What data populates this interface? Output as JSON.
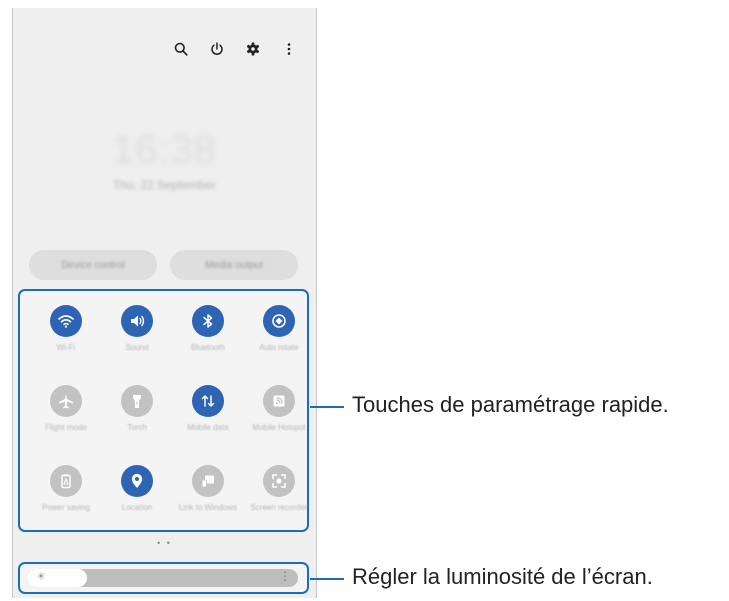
{
  "colors": {
    "accent": "#2e64b4",
    "callout": "#1a6cc0",
    "tile_off": "#c2c2c2"
  },
  "top_icons": [
    "search-icon",
    "power-icon",
    "gear-icon",
    "more-vert-icon"
  ],
  "lock_time": "16:38",
  "lock_date": "Thu, 22 September",
  "device_control_label": "Device control",
  "media_output_label": "Media output",
  "tiles": [
    {
      "label": "Wi-Fi",
      "icon": "wifi-icon",
      "active": true
    },
    {
      "label": "Sound",
      "icon": "sound-icon",
      "active": true
    },
    {
      "label": "Bluetooth",
      "icon": "bluetooth-icon",
      "active": true
    },
    {
      "label": "Auto rotate",
      "icon": "auto-rotate-icon",
      "active": true
    },
    {
      "label": "Flight mode",
      "icon": "airplane-icon",
      "active": false
    },
    {
      "label": "Torch",
      "icon": "torch-icon",
      "active": false
    },
    {
      "label": "Mobile data",
      "icon": "mobile-data-icon",
      "active": true
    },
    {
      "label": "Mobile Hotspot",
      "icon": "hotspot-icon",
      "active": false
    },
    {
      "label": "Power saving",
      "icon": "power-saving-icon",
      "active": false
    },
    {
      "label": "Location",
      "icon": "location-icon",
      "active": true
    },
    {
      "label": "Link to Windows",
      "icon": "link-windows-icon",
      "active": false
    },
    {
      "label": "Screen recorder",
      "icon": "screen-recorder-icon",
      "active": false
    }
  ],
  "page_indicator": "• •",
  "brightness": {
    "level": 0.22,
    "icon": "sun-icon"
  },
  "callouts": {
    "quick_settings": "Touches de paramétrage rapide.",
    "brightness": "Régler la luminosité de l’écran."
  }
}
